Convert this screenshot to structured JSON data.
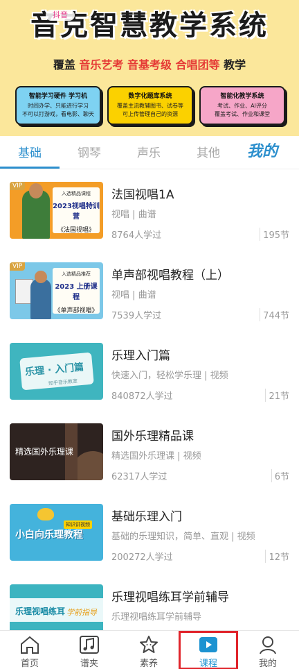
{
  "banner": {
    "title": "音克智慧教学系统",
    "tiktok": "抖音",
    "subtitle_prefix": "覆盖",
    "subtitle_highlight": "音乐艺考  音基考级  合唱团等",
    "subtitle_suffix": "教学",
    "cards": [
      {
        "title": "智能学习硬件 学习机",
        "lines": [
          "时间办学、只能进行学习",
          "不可以打游戏，看电影、聊天"
        ]
      },
      {
        "title": "数字化题库系统",
        "lines": [
          "覆盖主流教辅图书、试卷等",
          "可上传管理自己的资源"
        ]
      },
      {
        "title": "智能化教学系统",
        "lines": [
          "考试、作业、AI评分",
          "覆盖考试、作业和课堂"
        ]
      }
    ]
  },
  "tabs": {
    "items": [
      "基础",
      "钢琴",
      "声乐",
      "其他"
    ],
    "mine": "我的",
    "active": "基础"
  },
  "courses": [
    {
      "title": "法国视唱1A",
      "tags": "视唱 | 曲谱",
      "learners": "8764人学过",
      "lessons": "195节",
      "thumb": {
        "vip": "VIP",
        "line1": "入选精品课程",
        "line2": "2023视唱特训营",
        "line3": "《法国视唱》"
      }
    },
    {
      "title": "单声部视唱教程（上）",
      "tags": "视唱 | 曲谱",
      "learners": "7539人学过",
      "lessons": "744节",
      "thumb": {
        "vip": "VIP",
        "line1": "入选精品推荐",
        "line2": "2023 上册课程",
        "line3": "《单声部视唱》"
      }
    },
    {
      "title": "乐理入门篇",
      "tags": "快速入门，轻松学乐理 | 视频",
      "learners": "840872人学过",
      "lessons": "21节",
      "thumb": {
        "text": "乐理 · 入门篇",
        "sub": "知乎音乐教室"
      }
    },
    {
      "title": "国外乐理精品课",
      "tags": "精选国外乐理课 | 视频",
      "learners": "62317人学过",
      "lessons": "6节",
      "thumb": {
        "text": "精选国外乐理课"
      }
    },
    {
      "title": "基础乐理入门",
      "tags": "基础的乐理知识，简单、直观 | 视频",
      "learners": "200272人学过",
      "lessons": "12节",
      "thumb": {
        "text": "小白向乐理教程",
        "badge": "知识讲视频"
      }
    },
    {
      "title": "乐理视唱练耳学前辅导",
      "tags": "乐理视唱练耳学前辅导",
      "learners": "",
      "lessons": "",
      "thumb": {
        "text": "乐理视唱练耳",
        "text2": "学前指导"
      }
    }
  ],
  "bottom_nav": {
    "items": [
      {
        "label": "首页",
        "icon": "home-icon"
      },
      {
        "label": "谱夹",
        "icon": "music-note-icon"
      },
      {
        "label": "素养",
        "icon": "star-icon"
      },
      {
        "label": "课程",
        "icon": "play-icon"
      },
      {
        "label": "我的",
        "icon": "person-icon"
      }
    ],
    "active": "课程"
  },
  "colors": {
    "accent": "#2c8fcd",
    "banner_bg": "#fbe79b",
    "highlight_red": "#e53935",
    "nav_active_outline": "#e0242b"
  }
}
